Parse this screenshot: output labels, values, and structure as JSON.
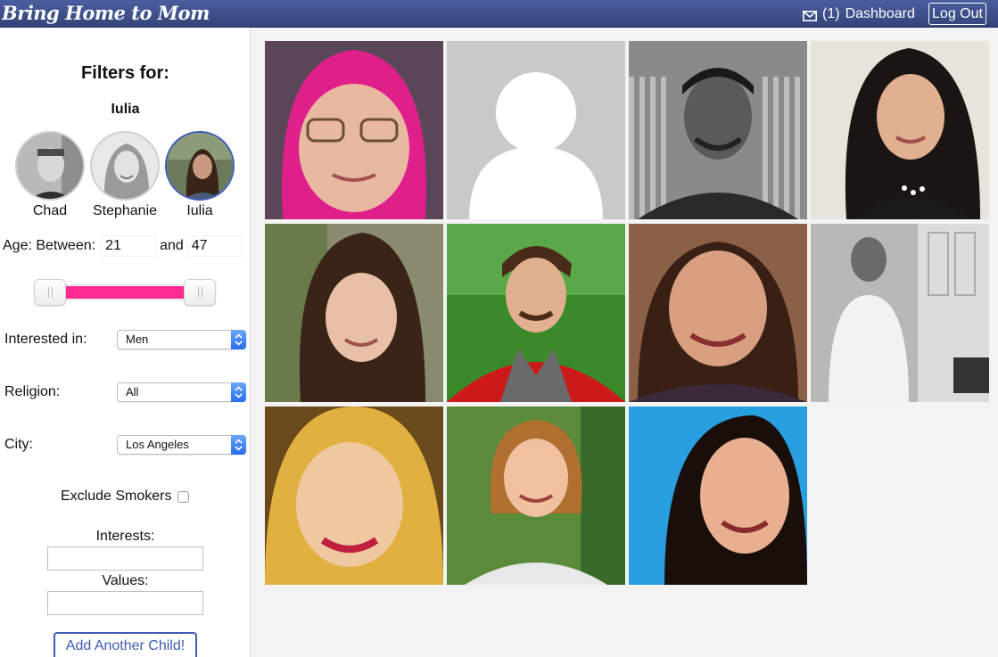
{
  "header": {
    "brand": "Bring Home to Mom",
    "dashboard_count": "(1)",
    "dashboard_label": "Dashboard",
    "logout_label": "Log Out"
  },
  "filters": {
    "title": "Filters for:",
    "selected_child": "Iulia",
    "children": [
      {
        "name": "Chad"
      },
      {
        "name": "Stephanie"
      },
      {
        "name": "Iulia"
      }
    ],
    "age": {
      "label": "Age: Between:",
      "min": "21",
      "and_label": "and",
      "max": "47"
    },
    "interested_label": "Interested in:",
    "interested_value": "Men",
    "religion_label": "Religion:",
    "religion_value": "All",
    "city_label": "City:",
    "city_value": "Los Angeles",
    "smokers_label": "Exclude Smokers",
    "interests_label": "Interests:",
    "values_label": "Values:",
    "add_child_label": "Add Another Child!"
  },
  "colors": {
    "header": "#3e4f8c",
    "slider": "#ff2b93",
    "accent": "#3e5bb5"
  }
}
